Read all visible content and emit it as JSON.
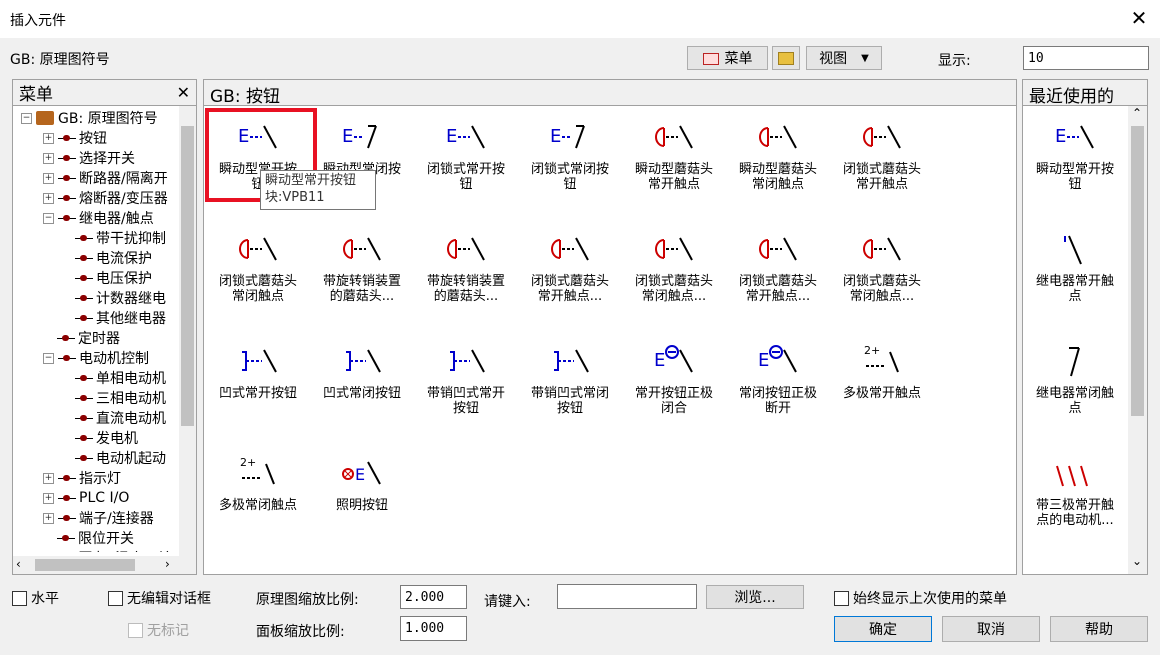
{
  "window": {
    "title": "插入元件"
  },
  "header": {
    "library_label": "GB: 原理图符号",
    "menu_label": "菜单",
    "view_label": "视图",
    "show_label": "显示:",
    "show_value": "10"
  },
  "menu_panel": {
    "title": "菜单",
    "root": "GB: 原理图符号",
    "items": [
      {
        "label": "按钮",
        "level": 1,
        "pm": "+"
      },
      {
        "label": "选择开关",
        "level": 1,
        "pm": "+"
      },
      {
        "label": "断路器/隔离开",
        "level": 1,
        "pm": "+"
      },
      {
        "label": "熔断器/变压器",
        "level": 1,
        "pm": "+"
      },
      {
        "label": "继电器/触点",
        "level": 1,
        "pm": "-"
      },
      {
        "label": "带干扰抑制",
        "level": 2,
        "pm": ""
      },
      {
        "label": "电流保护",
        "level": 2,
        "pm": ""
      },
      {
        "label": "电压保护",
        "level": 2,
        "pm": ""
      },
      {
        "label": "计数器继电",
        "level": 2,
        "pm": ""
      },
      {
        "label": "其他继电器",
        "level": 2,
        "pm": ""
      },
      {
        "label": "定时器",
        "level": 1,
        "pm": ""
      },
      {
        "label": "电动机控制",
        "level": 1,
        "pm": "-"
      },
      {
        "label": "单相电动机",
        "level": 2,
        "pm": ""
      },
      {
        "label": "三相电动机",
        "level": 2,
        "pm": ""
      },
      {
        "label": "直流电动机",
        "level": 2,
        "pm": ""
      },
      {
        "label": "发电机",
        "level": 2,
        "pm": ""
      },
      {
        "label": "电动机起动",
        "level": 2,
        "pm": ""
      },
      {
        "label": "指示灯",
        "level": 1,
        "pm": "+"
      },
      {
        "label": "PLC I/O",
        "level": 1,
        "pm": "+"
      },
      {
        "label": "端子/连接器",
        "level": 1,
        "pm": "+"
      },
      {
        "label": "限位开关",
        "level": 1,
        "pm": ""
      },
      {
        "label": "压力/.温度开关",
        "level": 1,
        "pm": ""
      }
    ]
  },
  "main_panel": {
    "title": "GB: 按钮",
    "symbols": [
      {
        "l1": "瞬动型常开按",
        "l2": "钮"
      },
      {
        "l1": "瞬动型常闭按",
        "l2": ""
      },
      {
        "l1": "闭锁式常开按",
        "l2": "钮"
      },
      {
        "l1": "闭锁式常闭按",
        "l2": "钮"
      },
      {
        "l1": "瞬动型蘑菇头",
        "l2": "常开触点"
      },
      {
        "l1": "瞬动型蘑菇头",
        "l2": "常闭触点"
      },
      {
        "l1": "闭锁式蘑菇头",
        "l2": "常开触点"
      },
      {
        "l1": "闭锁式蘑菇头",
        "l2": "常闭触点"
      },
      {
        "l1": "带旋转销装置",
        "l2": "的蘑菇头..."
      },
      {
        "l1": "带旋转销装置",
        "l2": "的蘑菇头..."
      },
      {
        "l1": "闭锁式蘑菇头",
        "l2": "常开触点..."
      },
      {
        "l1": "闭锁式蘑菇头",
        "l2": "常闭触点..."
      },
      {
        "l1": "闭锁式蘑菇头",
        "l2": "常开触点..."
      },
      {
        "l1": "闭锁式蘑菇头",
        "l2": "常闭触点..."
      },
      {
        "l1": "凹式常开按钮",
        "l2": ""
      },
      {
        "l1": "凹式常闭按钮",
        "l2": ""
      },
      {
        "l1": "带销凹式常开",
        "l2": "按钮"
      },
      {
        "l1": "带销凹式常闭",
        "l2": "按钮"
      },
      {
        "l1": "常开按钮正极",
        "l2": "闭合"
      },
      {
        "l1": "常闭按钮正极",
        "l2": "断开"
      },
      {
        "l1": "多极常开触点",
        "l2": ""
      },
      {
        "l1": "多极常闭触点",
        "l2": ""
      },
      {
        "l1": "照明按钮",
        "l2": ""
      }
    ],
    "tooltip_l1": "瞬动型常开按钮",
    "tooltip_l2": "块:VPB11"
  },
  "recent_panel": {
    "title": "最近使用的",
    "items": [
      {
        "l1": "瞬动型常开按",
        "l2": "钮"
      },
      {
        "l1": "继电器常开触",
        "l2": "点"
      },
      {
        "l1": "继电器常闭触",
        "l2": "点"
      },
      {
        "l1": "带三极常开触",
        "l2": "点的电动机..."
      }
    ]
  },
  "footer": {
    "horizontal": "水平",
    "no_edit_dialog": "无编辑对话框",
    "no_tag": "无标记",
    "schematic_scale_label": "原理图缩放比例:",
    "schematic_scale_value": "2.000",
    "panel_scale_label": "面板缩放比例:",
    "panel_scale_value": "1.000",
    "key_in_label": "请键入:",
    "key_in_value": "",
    "browse": "浏览...",
    "always_show_last": "始终显示上次使用的菜单",
    "ok": "确定",
    "cancel": "取消",
    "help": "帮助"
  },
  "colors": {
    "selection": "#e81123",
    "symbol_blue": "#0000cc",
    "symbol_red": "#cc0000"
  }
}
